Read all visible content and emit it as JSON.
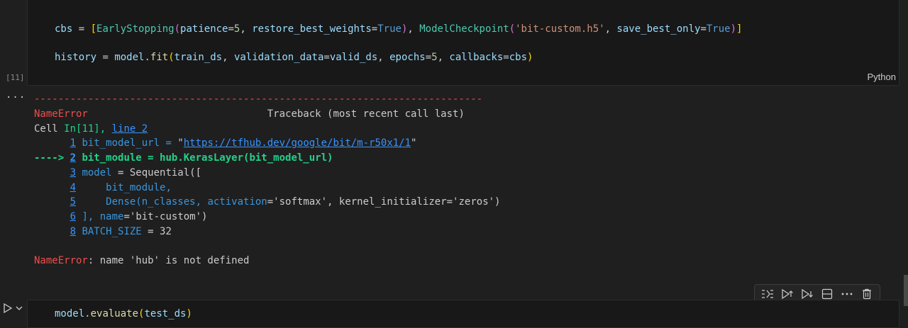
{
  "cell11": {
    "execution_count": "[11]",
    "language": "Python",
    "top_paren": ")",
    "line_cbs": {
      "var": "cbs",
      "eq": " = ",
      "b1": "[",
      "es": "EarlyStopping",
      "p1o": "(",
      "patience": "patience",
      "eq2": "=",
      "five": "5",
      "comma1": ", ",
      "rbw": "restore_best_weights",
      "eq3": "=",
      "true1": "True",
      "p1c": ")",
      "comma2": ", ",
      "mc": "ModelCheckpoint",
      "p2o": "(",
      "fname": "'bit-custom.h5'",
      "comma3": ", ",
      "sbo": "save_best_only",
      "eq4": "=",
      "true2": "True",
      "p2c": ")",
      "b1c": "]"
    },
    "line_hist": {
      "var": "history",
      "eq": " = ",
      "model": "model",
      "dot": ".",
      "fit": "fit",
      "po": "(",
      "train": "train_ds",
      "c1": ", ",
      "vd": "validation_data",
      "e1": "=",
      "valid": "valid_ds",
      "c2": ", ",
      "ep": "epochs",
      "e2": "=",
      "five": "5",
      "c3": ", ",
      "cb": "callbacks",
      "e3": "=",
      "cbs": "cbs",
      "pc": ")"
    }
  },
  "output": {
    "more": "···",
    "dashes": "---------------------------------------------------------------------------",
    "error_name": "NameError",
    "traceback_header": "Traceback (most recent call last)",
    "cell_prefix": "Cell ",
    "cell_ref": "In[11], ",
    "cell_line": "line 2",
    "lines": [
      {
        "num": "1",
        "pre": "      ",
        "code_a": " bit_model_url = ",
        "code_b": "\"",
        "link": "https://tfhub.dev/google/bit/m-r50x1/1",
        "code_c": "\""
      },
      {
        "num": "2",
        "pre": "----> ",
        "code": " bit_module = hub.KerasLayer(bit_model_url)"
      },
      {
        "num": "3",
        "pre": "      ",
        "code_a": " model",
        "code_b": " = Sequential(["
      },
      {
        "num": "4",
        "pre": "      ",
        "code": "     bit_module,"
      },
      {
        "num": "5",
        "pre": "      ",
        "code_a": "     Dense(n_classes, activation",
        "code_b": "=",
        "code_c": "'softmax', kernel_initializer",
        "code_d": "=",
        "code_e": "'zeros')"
      },
      {
        "num": "6",
        "pre": "      ",
        "code_a": " ], name",
        "code_b": "=",
        "code_c": "'bit-custom')"
      },
      {
        "num": "8",
        "pre": "      ",
        "code_a": " BATCH_SIZE",
        "code_b": " = 32"
      }
    ],
    "final_error_name": "NameError",
    "final_error_msg": ": name 'hub' is not defined"
  },
  "next_cell": {
    "code_a": "model",
    "code_b": ".",
    "code_c": "evaluate",
    "code_d": "(",
    "code_e": "test_ds",
    "code_f": ")"
  },
  "toolbar": {
    "icons": [
      "run-by-line-icon",
      "execute-above-icon",
      "execute-below-icon",
      "split-cell-icon",
      "more-actions-icon",
      "delete-icon"
    ]
  }
}
